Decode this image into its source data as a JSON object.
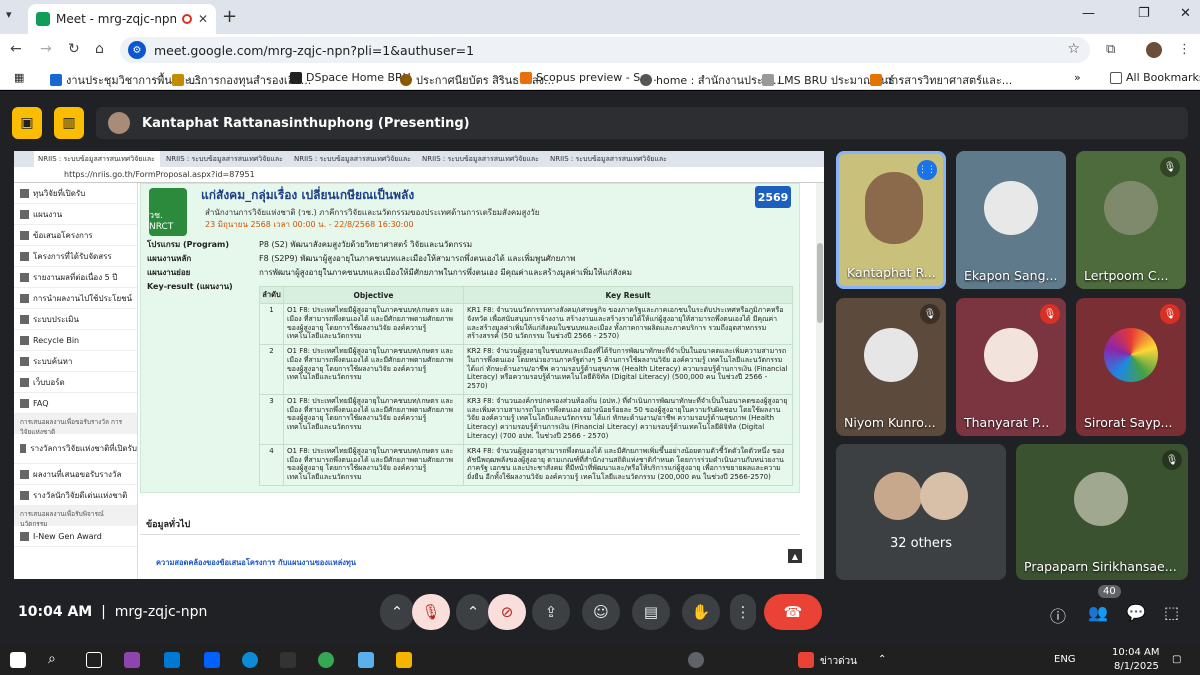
{
  "browser": {
    "tab_title": "Meet - mrg-zqjc-npn",
    "url": "meet.google.com/mrg-zqjc-npn?pli=1&authuser=1",
    "bookmarks": [
      "งานประชุมวิชาการพื้นประ...",
      "บริการกองทุนสำรองเลี้ย...",
      "DSpace Home BRU",
      "ประกาศนียบัตร สิรินธรแสง...",
      "Scopus preview - Sc...",
      "home : สำนักงานประกั...",
      "LMS BRU ประมาณพันธ์",
      "วารสารวิทยาศาสตร์และ..."
    ],
    "all_bookmarks": "All Bookmarks"
  },
  "meet": {
    "presenter": "Kantaphat Rattanasinthuphong (Presenting)",
    "time": "10:04 AM",
    "meeting_code": "mrg-zqjc-npn",
    "participant_count": "40",
    "participants": [
      {
        "name": "Kantaphat R...",
        "color": "#c9c07b"
      },
      {
        "name": "Ekapon Sang...",
        "color": "#5f7a8a"
      },
      {
        "name": "Lertpoom C...",
        "color": "#4d6b3c"
      },
      {
        "name": "Niyom Kunro...",
        "color": "#5c4a3c"
      },
      {
        "name": "Thanyarat P...",
        "color": "#7a3540"
      },
      {
        "name": "Sirorat Sayp...",
        "color": "#7a2f35"
      },
      {
        "name": "Prapaparn Sirikhansae...",
        "color": "#3b5231"
      }
    ],
    "others_label": "32 others"
  },
  "shared": {
    "tabs": [
      "NRIIS : ระบบข้อมูลสารสนเทศวิจัยและ",
      "NRIIS : ระบบข้อมูลสารสนเทศวิจัยและ",
      "NRIIS : ระบบข้อมูลสารสนเทศวิจัยและ",
      "NRIIS : ระบบข้อมูลสารสนเทศวิจัยและ",
      "NRIIS : ระบบข้อมูลสารสนเทศวิจัยและ"
    ],
    "url": "https://nriis.go.th/FormProposal.aspx?id=87951",
    "sidebar": [
      "ทุนวิจัยที่เปิดรับ",
      "แผนงาน",
      "ข้อเสนอโครงการ",
      "โครงการที่ได้รับจัดสรร",
      "รายงานผลที่ต่อเนื่อง 5 ปี",
      "การนำผลงานไปใช้ประโยชน์",
      "ระบบประเมิน",
      "Recycle Bin",
      "ระบบค้นหา",
      "เว็บบอร์ด",
      "FAQ"
    ],
    "sidebar_head1": "การเสนอผลงานเพื่อขอรับรางวัล การวิจัยแห่งชาติ",
    "sidebar_item12": "รางวัลการวิจัยแห่งชาติที่เปิดรับ",
    "sidebar_item13": "ผลงานที่เสนอขอรับรางวัล",
    "sidebar_item14": "รางวัลนักวิจัยดีเด่นแห่งชาติ",
    "sidebar_head2": "การเสนอผลงานเพื่อรับพิจารณ์ นวัตกรรม",
    "sidebar_item15": "I-New Gen Award",
    "project": {
      "title": "แก่สังคม_กลุ่มเรื่อง เปลี่ยนเกษียณเป็นพลัง",
      "org": "สำนักงานการวิจัยแห่งชาติ (วช.) ภาคีการวิจัยและนวัตกรรมของประเทศด้านการเตรียมสังคมสูงวัย",
      "date": "23 มิถุนายน 2568 เวลา 00:00 น. - 22/8/2568 16:30:00",
      "year": "2569",
      "logo_text": "วช. NRCT",
      "program_k": "โปรแกรม (Program)",
      "program_v": "P8 (S2) พัฒนาสังคมสูงวัยด้วยวิทยาศาสตร์ วิจัยและนวัตกรรม",
      "plan_k": "แผนงานหลัก",
      "plan_v": "F8 (S2P9) พัฒนาผู้สูงอายุในภาคชนบทและเมืองให้สามารถพึ่งตนเองได้ และเพิ่มพูนศักยภาพ",
      "subplan_k": "แผนงานย่อย",
      "subplan_v": "การพัฒนาผู้สูงอายุในภาคชนบทและเมืองให้มีศักยภาพในการพึ่งตนเอง มีคุณค่าและสร้างมูลค่าเพิ่มให้แก่สังคม",
      "kr_k": "Key-result (แผนงาน)",
      "col_no": "ลำดับ",
      "col_obj": "Objective",
      "col_kr": "Key Result",
      "rows": [
        {
          "no": "1",
          "obj": "O1 F8: ประเทศไทยมีผู้สูงอายุในภาคชนบท/เกษตร และเมือง ที่สามารถพึ่งตนเองได้ และมีศักยภาพตามศักยภาพของผู้สูงอายุ โดยการใช้ผลงานวิจัย องค์ความรู้ เทคโนโลยีและนวัตกรรม",
          "kr": "KR1 F8: จำนวนนวัตกรรมทางสังคม/เศรษฐกิจ ของภาครัฐและภาคเอกชนในระดับประเทศหรือภูมิภาคหรือจังหวัด เพื่อสนับสนุนการจ้างงาน สร้างงานและสร้างรายได้ให้แก่ผู้สูงอายุให้สามารถพึ่งตนเองได้ มีคุณค่าและสร้างมูลค่าเพิ่มให้แก่สังคมในชนบทและเมือง ทั้งภาคการผลิตและภาคบริการ รวมถึงอุตสาหกรรมสร้างสรรค์ (50 นวัตกรรม ในช่วงปี 2566 - 2570)"
        },
        {
          "no": "2",
          "obj": "O1 F8: ประเทศไทยมีผู้สูงอายุในภาคชนบท/เกษตร และเมือง ที่สามารถพึ่งตนเองได้ และมีศักยภาพตามศักยภาพของผู้สูงอายุ โดยการใช้ผลงานวิจัย องค์ความรู้ เทคโนโลยีและนวัตกรรม",
          "kr": "KR2 F8: จำนวนผู้สูงอายุในชนบทและเมืองที่ได้รับการพัฒนาทักษะที่จำเป็นในอนาคตและเพิ่มความสามารถในการพึ่งตนเอง โดยหน่วยงานภาครัฐต่างๆ 5 ด้านการใช้ผลงานวิจัย องค์ความรู้ เทคโนโลยีและนวัตกรรม ได้แก่ ทักษะด้านงาน/อาชีพ ความรอบรู้ด้านสุขภาพ (Health Literacy) ความรอบรู้ด้านการเงิน (Financial Literacy) หรือความรอบรู้ด้านเทคโนโลยีดิจิทัล (Digital Literacy) (500,000 คน ในช่วงปี 2566 - 2570)"
        },
        {
          "no": "3",
          "obj": "O1 F8: ประเทศไทยมีผู้สูงอายุในภาคชนบท/เกษตร และเมือง ที่สามารถพึ่งตนเองได้ และมีศักยภาพตามศักยภาพของผู้สูงอายุ โดยการใช้ผลงานวิจัย องค์ความรู้ เทคโนโลยีและนวัตกรรม",
          "kr": "KR3 F8: จำนวนองค์กรปกครองส่วนท้องถิ่น (อปท.) ที่ดำเนินการพัฒนาทักษะที่จำเป็นในอนาคตของผู้สูงอายุ และเพิ่มความสามารถในการพึ่งตนเอง อย่างน้อยร้อยละ 50 ของผู้สูงอายุในความรับผิดชอบ โดยใช้ผลงานวิจัย องค์ความรู้ เทคโนโลยีและนวัตกรรม ได้แก่ ทักษะด้านงาน/อาชีพ ความรอบรู้ด้านสุขภาพ (Health Literacy) ความรอบรู้ด้านการเงิน (Financial Literacy) ความรอบรู้ด้านเทคโนโลยีดิจิทัล (Digital Literacy) (700 อปท. ในช่วงปี 2566 - 2570)"
        },
        {
          "no": "4",
          "obj": "O1 F8: ประเทศไทยมีผู้สูงอายุในภาคชนบท/เกษตร และเมือง ที่สามารถพึ่งตนเองได้ และมีศักยภาพตามศักยภาพของผู้สูงอายุ โดยการใช้ผลงานวิจัย องค์ความรู้ เทคโนโลยีและนวัตกรรม",
          "kr": "KR4 F8: จำนวนผู้สูงอายุสามารถพึ่งตนเองได้ และมีศักยภาพเพิ่มขึ้นอย่างน้อยตามตัวชี้วัดตัวใดตัวหนึ่ง ของดัชนีพฤฒพลังของผู้สูงอายุ ตามเกณฑ์ที่สำนักงานสถิติแห่งชาติกำหนด โดยการร่วมดำเนินงานกับหน่วยงานภาครัฐ เอกชน และประชาสังคม ที่มีหน้าที่พัฒนาและ/หรือให้บริการแก่ผู้สูงอายุ เพื่อการขยายผลและความยั่งยืน อีกทั้งใช้ผลงานวิจัย องค์ความรู้ เทคโนโลยีและนวัตกรรม (200,000 คน ในช่วงปี 2566-2570)"
        }
      ],
      "general_tab": "ข้อมูลทั่วไป",
      "consistency": "ความสอดคล้องของข้อเสนอโครงการ กับแผนงานของแหล่งทุน"
    }
  },
  "taskbar": {
    "lang": "ENG",
    "time": "10:04 AM",
    "date": "8/1/2025",
    "news": "ข่าวด่วน"
  }
}
